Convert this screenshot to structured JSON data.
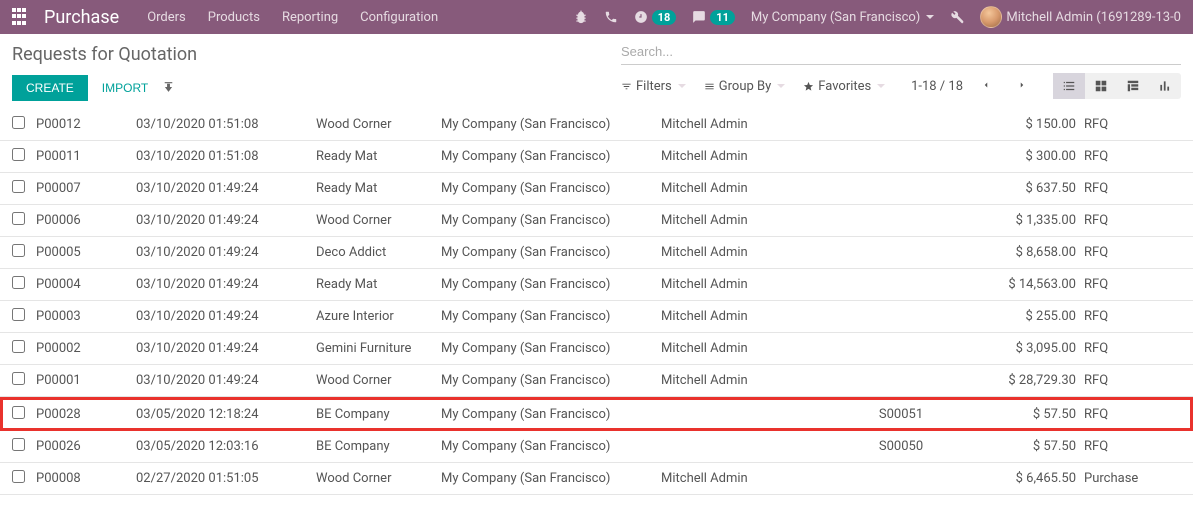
{
  "app": {
    "name": "Purchase"
  },
  "menu": [
    "Orders",
    "Products",
    "Reporting",
    "Configuration"
  ],
  "systray": {
    "activities_badge": "18",
    "messages_badge": "11",
    "company": "My Company (San Francisco)",
    "user": "Mitchell Admin (1691289-13-0"
  },
  "control": {
    "title": "Requests for Quotation",
    "create": "CREATE",
    "import": "IMPORT",
    "search_placeholder": "Search...",
    "filters": "Filters",
    "groupby": "Group By",
    "favorites": "Favorites",
    "pager": "1-18 / 18"
  },
  "rows": [
    {
      "ref": "P00012",
      "date": "03/10/2020 01:51:08",
      "vendor": "Wood Corner",
      "company": "My Company (San Francisco)",
      "rep": "Mitchell Admin",
      "src": "",
      "total": "$ 150.00",
      "status": "RFQ",
      "hl": false
    },
    {
      "ref": "P00011",
      "date": "03/10/2020 01:51:08",
      "vendor": "Ready Mat",
      "company": "My Company (San Francisco)",
      "rep": "Mitchell Admin",
      "src": "",
      "total": "$ 300.00",
      "status": "RFQ",
      "hl": false
    },
    {
      "ref": "P00007",
      "date": "03/10/2020 01:49:24",
      "vendor": "Ready Mat",
      "company": "My Company (San Francisco)",
      "rep": "Mitchell Admin",
      "src": "",
      "total": "$ 637.50",
      "status": "RFQ",
      "hl": false
    },
    {
      "ref": "P00006",
      "date": "03/10/2020 01:49:24",
      "vendor": "Wood Corner",
      "company": "My Company (San Francisco)",
      "rep": "Mitchell Admin",
      "src": "",
      "total": "$ 1,335.00",
      "status": "RFQ",
      "hl": false
    },
    {
      "ref": "P00005",
      "date": "03/10/2020 01:49:24",
      "vendor": "Deco Addict",
      "company": "My Company (San Francisco)",
      "rep": "Mitchell Admin",
      "src": "",
      "total": "$ 8,658.00",
      "status": "RFQ",
      "hl": false
    },
    {
      "ref": "P00004",
      "date": "03/10/2020 01:49:24",
      "vendor": "Ready Mat",
      "company": "My Company (San Francisco)",
      "rep": "Mitchell Admin",
      "src": "",
      "total": "$ 14,563.00",
      "status": "RFQ",
      "hl": false
    },
    {
      "ref": "P00003",
      "date": "03/10/2020 01:49:24",
      "vendor": "Azure Interior",
      "company": "My Company (San Francisco)",
      "rep": "Mitchell Admin",
      "src": "",
      "total": "$ 255.00",
      "status": "RFQ",
      "hl": false
    },
    {
      "ref": "P00002",
      "date": "03/10/2020 01:49:24",
      "vendor": "Gemini Furniture",
      "company": "My Company (San Francisco)",
      "rep": "Mitchell Admin",
      "src": "",
      "total": "$ 3,095.00",
      "status": "RFQ",
      "hl": false
    },
    {
      "ref": "P00001",
      "date": "03/10/2020 01:49:24",
      "vendor": "Wood Corner",
      "company": "My Company (San Francisco)",
      "rep": "Mitchell Admin",
      "src": "",
      "total": "$ 28,729.30",
      "status": "RFQ",
      "hl": false
    },
    {
      "ref": "P00028",
      "date": "03/05/2020 12:18:24",
      "vendor": "BE Company",
      "company": "My Company (San Francisco)",
      "rep": "",
      "src": "S00051",
      "total": "$ 57.50",
      "status": "RFQ",
      "hl": true
    },
    {
      "ref": "P00026",
      "date": "03/05/2020 12:03:16",
      "vendor": "BE Company",
      "company": "My Company (San Francisco)",
      "rep": "",
      "src": "S00050",
      "total": "$ 57.50",
      "status": "RFQ",
      "hl": false
    },
    {
      "ref": "P00008",
      "date": "02/27/2020 01:51:05",
      "vendor": "Wood Corner",
      "company": "My Company (San Francisco)",
      "rep": "Mitchell Admin",
      "src": "",
      "total": "$ 6,465.50",
      "status": "Purchase",
      "hl": false
    }
  ]
}
